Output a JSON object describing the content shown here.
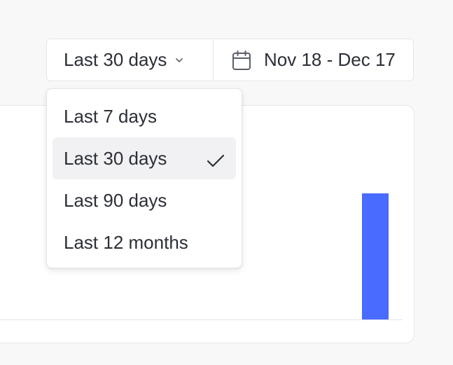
{
  "header": {
    "range_selected": "Last 30 days",
    "date_range": "Nov 18 - Dec 17"
  },
  "dropdown": {
    "items": [
      {
        "label": "Last 7 days",
        "selected": false
      },
      {
        "label": "Last 30 days",
        "selected": true
      },
      {
        "label": "Last 90 days",
        "selected": false
      },
      {
        "label": "Last 12 months",
        "selected": false
      }
    ]
  },
  "chart": {
    "bar_color": "#4a6bff",
    "visible_bar_fraction": 0.59
  }
}
